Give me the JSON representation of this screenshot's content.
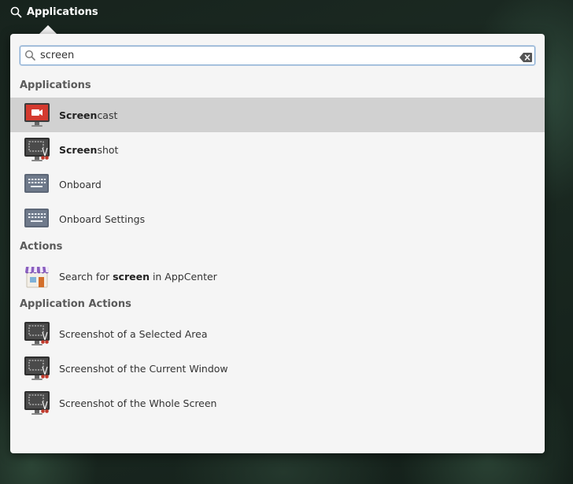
{
  "panel": {
    "applications_label": "Applications"
  },
  "search": {
    "value": "screen",
    "query_bold": "screen"
  },
  "categories": {
    "applications": "Applications",
    "actions": "Actions",
    "application_actions": "Application Actions"
  },
  "apps": [
    {
      "match": "Screen",
      "rest": "cast",
      "icon": "screencast-icon",
      "selected": true
    },
    {
      "match": "Screen",
      "rest": "shot",
      "icon": "screenshot-icon",
      "selected": false
    },
    {
      "match": "",
      "rest": "Onboard",
      "icon": "keyboard-icon",
      "selected": false
    },
    {
      "match": "",
      "rest": "Onboard Settings",
      "icon": "keyboard-icon",
      "selected": false
    }
  ],
  "actions": [
    {
      "prefix": "Search for ",
      "bold": "screen",
      "suffix": " in AppCenter",
      "icon": "appcenter-icon"
    }
  ],
  "app_actions": [
    {
      "label": "Screenshot of a Selected Area",
      "icon": "screenshot-icon"
    },
    {
      "label": "Screenshot of the Current Window",
      "icon": "screenshot-icon"
    },
    {
      "label": "Screenshot of the Whole Screen",
      "icon": "screenshot-icon"
    }
  ],
  "colors": {
    "selection": "#d1d1d1",
    "popover": "#f5f5f5",
    "search_focus": "#7fa6cf",
    "screencast_red": "#d43a2f"
  }
}
